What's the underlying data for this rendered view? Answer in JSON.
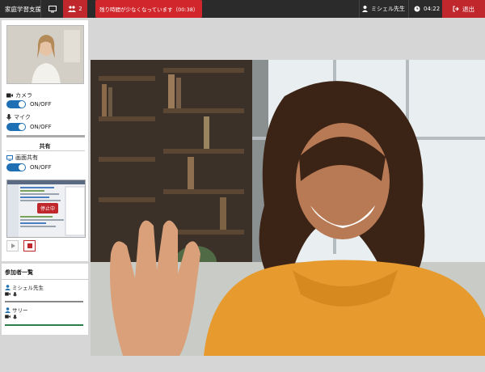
{
  "topbar": {
    "app_title": "家庭学習支援",
    "screen_icon": "monitor-icon",
    "participants_icon": "people-icon",
    "participant_count": "2",
    "alert_text": "残り時間が少なくなっています（00:38）",
    "user_name": "ミシェル先生",
    "time": "04:22",
    "exit_label": "退出",
    "colors": {
      "bar": "#2b2b2b",
      "accent": "#c0272d"
    }
  },
  "sidebar": {
    "camera": {
      "label": "カメラ",
      "toggle_label": "ON/OFF"
    },
    "mic": {
      "label": "マイク",
      "toggle_label": "ON/OFF"
    },
    "share_section": "共有",
    "screen_share": {
      "label": "画面共有",
      "toggle_label": "ON/OFF"
    },
    "stop_badge": "停止中",
    "participants_title": "参加者一覧",
    "participants": [
      {
        "name": "ミシェル先生"
      },
      {
        "name": "サリー"
      }
    ]
  }
}
